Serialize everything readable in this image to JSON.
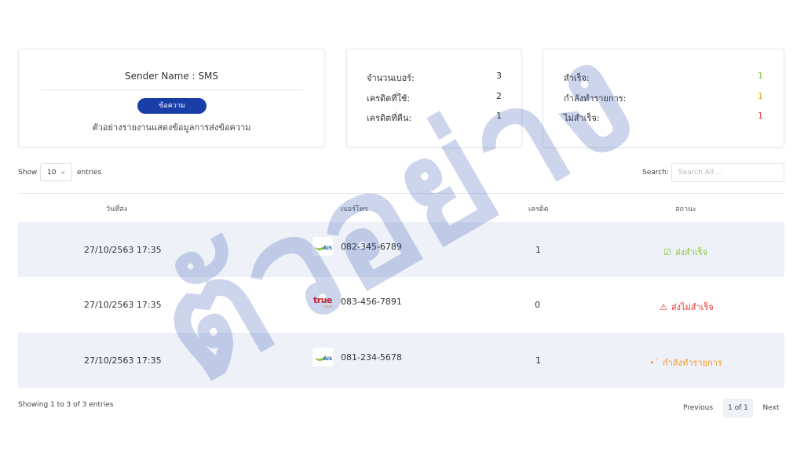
{
  "sender_card": {
    "title": "Sender Name : SMS",
    "button_label": "ข้อความ",
    "description": "ตัวอย่างรายงานแสดงข้อมูลการส่งข้อความ"
  },
  "credit_card": {
    "rows": [
      {
        "label": "จำนวนเบอร์:",
        "value": "3"
      },
      {
        "label": "เครดิตที่ใช้:",
        "value": "2"
      },
      {
        "label": "เครดิตที่คืน:",
        "value": "1"
      }
    ]
  },
  "status_card": {
    "rows": [
      {
        "label": "สำเร็จ:",
        "value": "1",
        "color": "#8cc63f"
      },
      {
        "label": "กำลังทำรายการ:",
        "value": "1",
        "color": "#f29a1f"
      },
      {
        "label": "ไม่สำเร็จ:",
        "value": "1",
        "color": "#e53935"
      }
    ]
  },
  "controls": {
    "show_label": "Show",
    "page_length": "10",
    "entries_label": "entries",
    "search_label": "Search:",
    "search_placeholder": "Search All ..."
  },
  "table": {
    "headers": [
      "วันที่ส่ง",
      "เบอร์โทร",
      "เครดิต",
      "สถานะ"
    ],
    "rows": [
      {
        "date": "27/10/2563 17:35",
        "carrier": "AIS",
        "phone": "082-345-6789",
        "credit": "1",
        "status": "ส่งสำเร็จ",
        "status_icon": "check-square-icon",
        "status_color": "#8cc63f"
      },
      {
        "date": "27/10/2563 17:35",
        "carrier": "true",
        "phone": "083-456-7891",
        "credit": "0",
        "status": "ส่งไม่สำเร็จ",
        "status_icon": "warning-triangle-icon",
        "status_color": "#e53935"
      },
      {
        "date": "27/10/2563 17:35",
        "carrier": "AIS",
        "phone": "081-234-5678",
        "credit": "1",
        "status": "กำลังทำรายการ",
        "status_icon": "loading-dots-icon",
        "status_color": "#f29a1f"
      }
    ]
  },
  "footer": {
    "info": "Showing 1 to 3 of 3 entries",
    "previous": "Previous",
    "current_page": "1 of 1",
    "next": "Next"
  },
  "watermark": {
    "text": "ตัวอย่าง",
    "color": "#1a3ea8"
  },
  "carriers": {
    "ais_label": "AIS",
    "true_label": "true",
    "true_sub": "move"
  }
}
